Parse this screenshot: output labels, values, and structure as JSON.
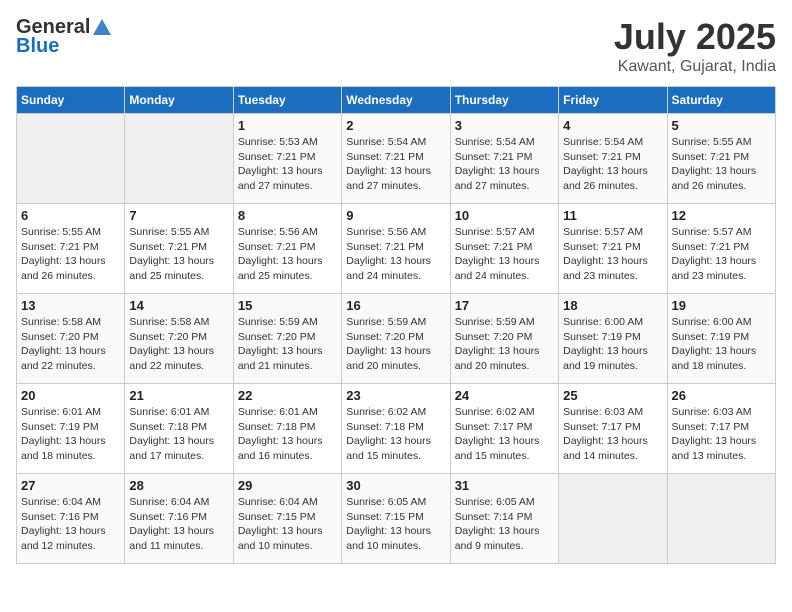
{
  "header": {
    "logo_general": "General",
    "logo_blue": "Blue",
    "title": "July 2025",
    "subtitle": "Kawant, Gujarat, India"
  },
  "weekdays": [
    "Sunday",
    "Monday",
    "Tuesday",
    "Wednesday",
    "Thursday",
    "Friday",
    "Saturday"
  ],
  "weeks": [
    [
      {
        "day": "",
        "info": ""
      },
      {
        "day": "",
        "info": ""
      },
      {
        "day": "1",
        "info": "Sunrise: 5:53 AM\nSunset: 7:21 PM\nDaylight: 13 hours\nand 27 minutes."
      },
      {
        "day": "2",
        "info": "Sunrise: 5:54 AM\nSunset: 7:21 PM\nDaylight: 13 hours\nand 27 minutes."
      },
      {
        "day": "3",
        "info": "Sunrise: 5:54 AM\nSunset: 7:21 PM\nDaylight: 13 hours\nand 27 minutes."
      },
      {
        "day": "4",
        "info": "Sunrise: 5:54 AM\nSunset: 7:21 PM\nDaylight: 13 hours\nand 26 minutes."
      },
      {
        "day": "5",
        "info": "Sunrise: 5:55 AM\nSunset: 7:21 PM\nDaylight: 13 hours\nand 26 minutes."
      }
    ],
    [
      {
        "day": "6",
        "info": "Sunrise: 5:55 AM\nSunset: 7:21 PM\nDaylight: 13 hours\nand 26 minutes."
      },
      {
        "day": "7",
        "info": "Sunrise: 5:55 AM\nSunset: 7:21 PM\nDaylight: 13 hours\nand 25 minutes."
      },
      {
        "day": "8",
        "info": "Sunrise: 5:56 AM\nSunset: 7:21 PM\nDaylight: 13 hours\nand 25 minutes."
      },
      {
        "day": "9",
        "info": "Sunrise: 5:56 AM\nSunset: 7:21 PM\nDaylight: 13 hours\nand 24 minutes."
      },
      {
        "day": "10",
        "info": "Sunrise: 5:57 AM\nSunset: 7:21 PM\nDaylight: 13 hours\nand 24 minutes."
      },
      {
        "day": "11",
        "info": "Sunrise: 5:57 AM\nSunset: 7:21 PM\nDaylight: 13 hours\nand 23 minutes."
      },
      {
        "day": "12",
        "info": "Sunrise: 5:57 AM\nSunset: 7:21 PM\nDaylight: 13 hours\nand 23 minutes."
      }
    ],
    [
      {
        "day": "13",
        "info": "Sunrise: 5:58 AM\nSunset: 7:20 PM\nDaylight: 13 hours\nand 22 minutes."
      },
      {
        "day": "14",
        "info": "Sunrise: 5:58 AM\nSunset: 7:20 PM\nDaylight: 13 hours\nand 22 minutes."
      },
      {
        "day": "15",
        "info": "Sunrise: 5:59 AM\nSunset: 7:20 PM\nDaylight: 13 hours\nand 21 minutes."
      },
      {
        "day": "16",
        "info": "Sunrise: 5:59 AM\nSunset: 7:20 PM\nDaylight: 13 hours\nand 20 minutes."
      },
      {
        "day": "17",
        "info": "Sunrise: 5:59 AM\nSunset: 7:20 PM\nDaylight: 13 hours\nand 20 minutes."
      },
      {
        "day": "18",
        "info": "Sunrise: 6:00 AM\nSunset: 7:19 PM\nDaylight: 13 hours\nand 19 minutes."
      },
      {
        "day": "19",
        "info": "Sunrise: 6:00 AM\nSunset: 7:19 PM\nDaylight: 13 hours\nand 18 minutes."
      }
    ],
    [
      {
        "day": "20",
        "info": "Sunrise: 6:01 AM\nSunset: 7:19 PM\nDaylight: 13 hours\nand 18 minutes."
      },
      {
        "day": "21",
        "info": "Sunrise: 6:01 AM\nSunset: 7:18 PM\nDaylight: 13 hours\nand 17 minutes."
      },
      {
        "day": "22",
        "info": "Sunrise: 6:01 AM\nSunset: 7:18 PM\nDaylight: 13 hours\nand 16 minutes."
      },
      {
        "day": "23",
        "info": "Sunrise: 6:02 AM\nSunset: 7:18 PM\nDaylight: 13 hours\nand 15 minutes."
      },
      {
        "day": "24",
        "info": "Sunrise: 6:02 AM\nSunset: 7:17 PM\nDaylight: 13 hours\nand 15 minutes."
      },
      {
        "day": "25",
        "info": "Sunrise: 6:03 AM\nSunset: 7:17 PM\nDaylight: 13 hours\nand 14 minutes."
      },
      {
        "day": "26",
        "info": "Sunrise: 6:03 AM\nSunset: 7:17 PM\nDaylight: 13 hours\nand 13 minutes."
      }
    ],
    [
      {
        "day": "27",
        "info": "Sunrise: 6:04 AM\nSunset: 7:16 PM\nDaylight: 13 hours\nand 12 minutes."
      },
      {
        "day": "28",
        "info": "Sunrise: 6:04 AM\nSunset: 7:16 PM\nDaylight: 13 hours\nand 11 minutes."
      },
      {
        "day": "29",
        "info": "Sunrise: 6:04 AM\nSunset: 7:15 PM\nDaylight: 13 hours\nand 10 minutes."
      },
      {
        "day": "30",
        "info": "Sunrise: 6:05 AM\nSunset: 7:15 PM\nDaylight: 13 hours\nand 10 minutes."
      },
      {
        "day": "31",
        "info": "Sunrise: 6:05 AM\nSunset: 7:14 PM\nDaylight: 13 hours\nand 9 minutes."
      },
      {
        "day": "",
        "info": ""
      },
      {
        "day": "",
        "info": ""
      }
    ]
  ]
}
